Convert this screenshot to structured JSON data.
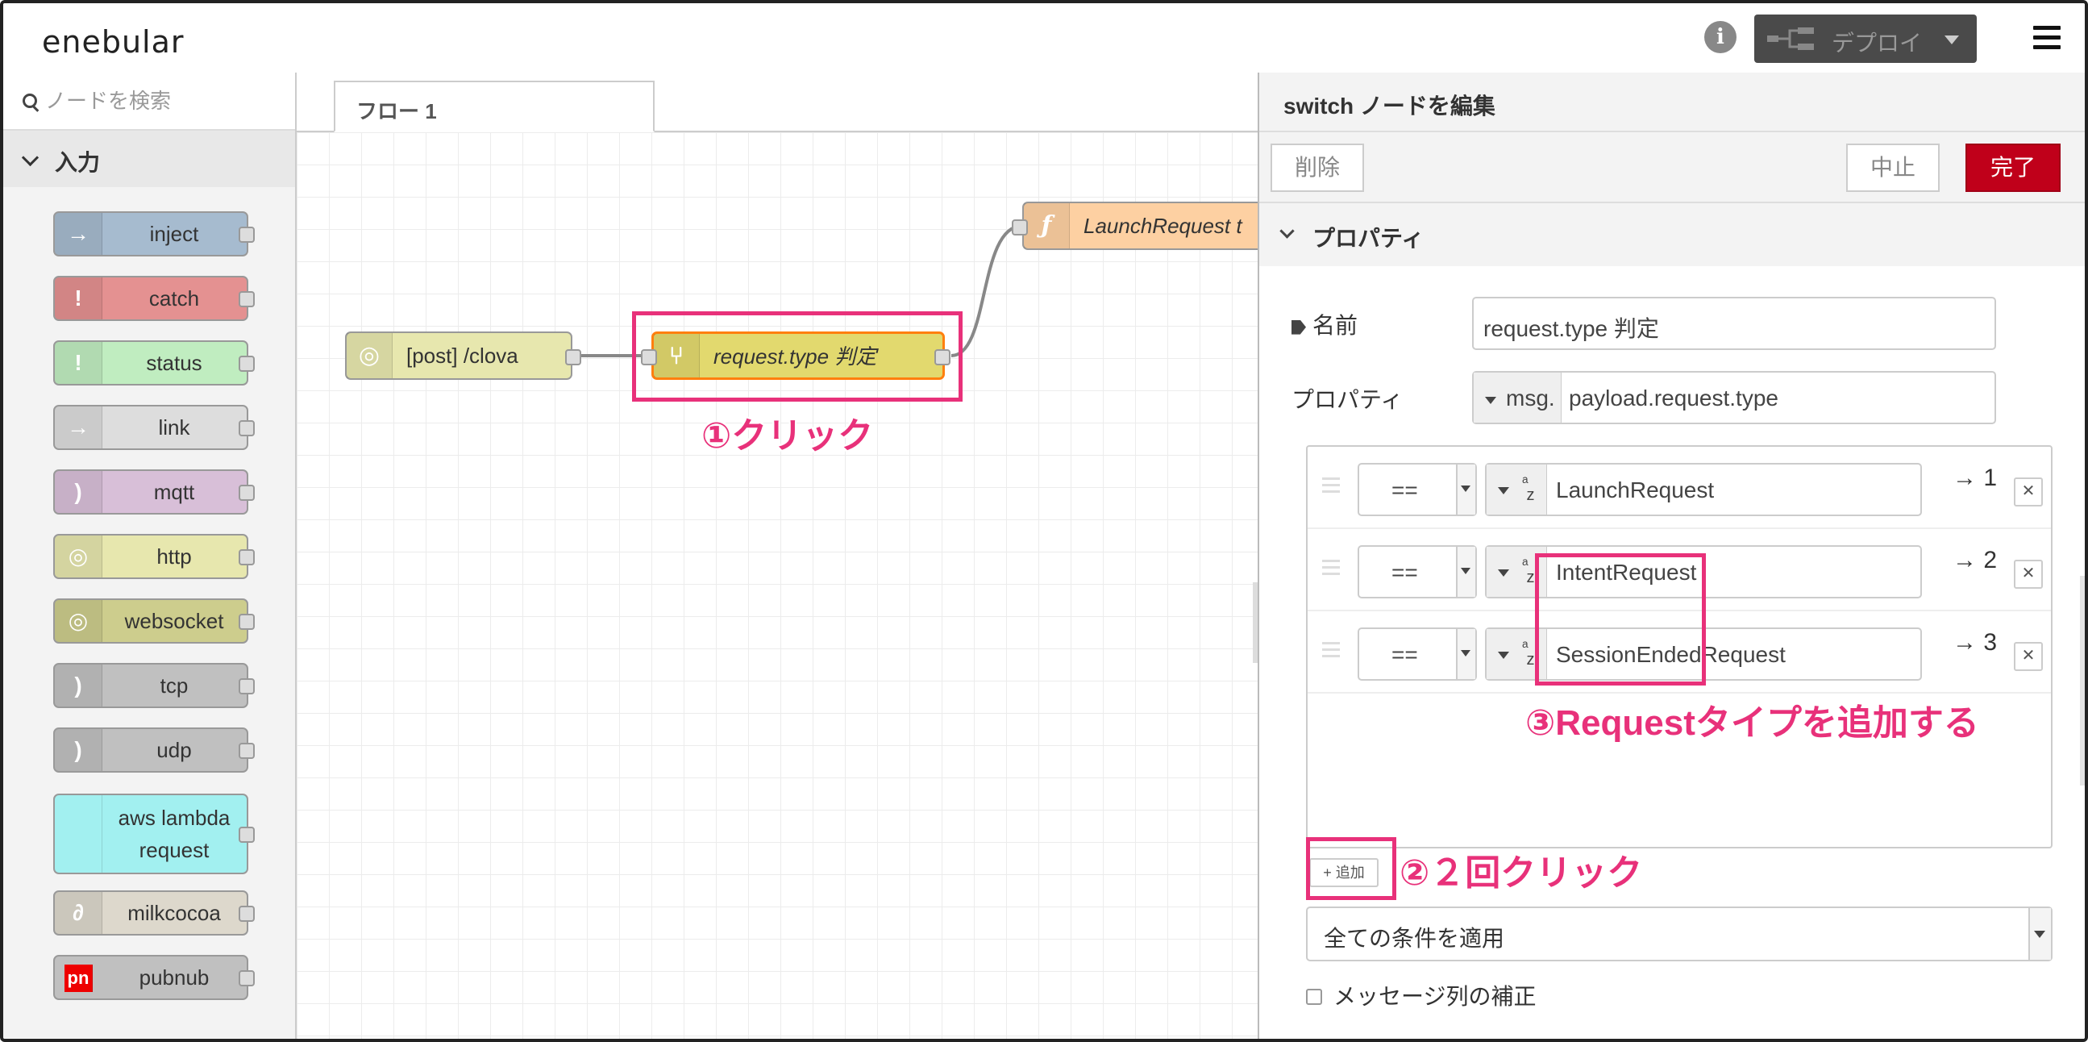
{
  "header": {
    "logo": "enebular",
    "deploy_label": "デプロイ"
  },
  "palette": {
    "search_placeholder": "ノードを検索",
    "category": "入力",
    "nodes": [
      {
        "label": "inject",
        "color": "#a6bbcf",
        "icon": "→"
      },
      {
        "label": "catch",
        "color": "#e49191",
        "icon": "!"
      },
      {
        "label": "status",
        "color": "#c0edc0",
        "icon": "!"
      },
      {
        "label": "link",
        "color": "#dddddd",
        "icon": "→"
      },
      {
        "label": "mqtt",
        "color": "#d8bfd8",
        "icon": ")"
      },
      {
        "label": "http",
        "color": "#e7e7ae",
        "icon": "◎"
      },
      {
        "label": "websocket",
        "color": "#cdcd8d",
        "icon": "◎"
      },
      {
        "label": "tcp",
        "color": "#c0c0c0",
        "icon": ")"
      },
      {
        "label": "udp",
        "color": "#c0c0c0",
        "icon": ")"
      },
      {
        "label": "aws lambda request",
        "color": "#a2f0f0",
        "icon": ""
      },
      {
        "label": "milkcocoa",
        "color": "#ddd8cc",
        "icon": "∂"
      },
      {
        "label": "pubnub",
        "color": "#c0c0c0",
        "icon": "pn"
      }
    ]
  },
  "workspace": {
    "tab_label": "フロー 1",
    "nodes": {
      "http_in": "[post] /clova",
      "switch": "request.type 判定",
      "function": "LaunchRequest t"
    },
    "annotations": {
      "step1": "①クリック",
      "step2": "②２回クリック",
      "step3": "③Requestタイプを追加する"
    }
  },
  "editor": {
    "title": "switch ノードを編集",
    "delete_label": "削除",
    "cancel_label": "中止",
    "done_label": "完了",
    "section_title": "プロパティ",
    "name_label": "名前",
    "name_value": "request.type 判定",
    "property_label": "プロパティ",
    "property_prefix": "msg.",
    "property_value": "payload.request.type",
    "rules": [
      {
        "op": "==",
        "value": "LaunchRequest",
        "output": "→ 1"
      },
      {
        "op": "==",
        "value": "IntentRequest",
        "output": "→ 2"
      },
      {
        "op": "==",
        "value": "SessionEndedRequest",
        "output": "→ 3"
      }
    ],
    "add_label": "+ 追加",
    "apply_label": "全ての条件を適用",
    "recompute_label": "メッセージ列の補正"
  }
}
